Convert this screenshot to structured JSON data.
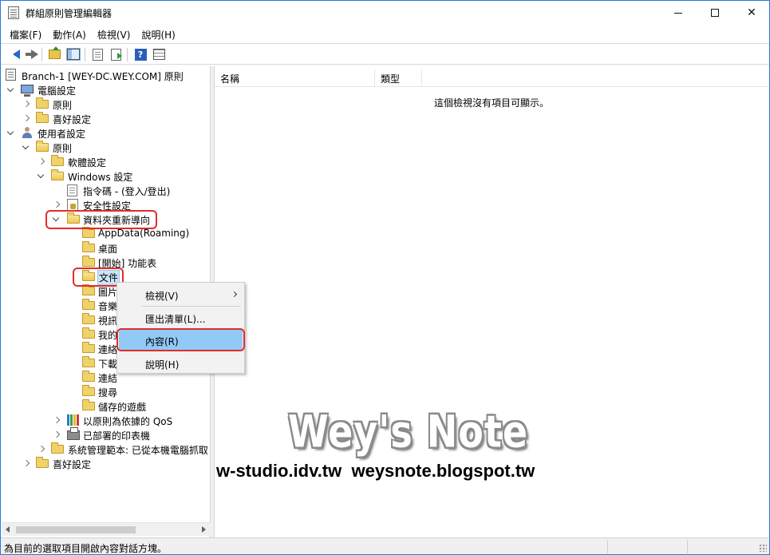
{
  "window": {
    "title": "群組原則管理編輯器",
    "minimize_glyph": "",
    "close_glyph": "✕"
  },
  "menubar": {
    "items": [
      "檔案(F)",
      "動作(A)",
      "檢視(V)",
      "說明(H)"
    ]
  },
  "toolbar": {
    "icons": [
      "back-arrow-icon",
      "forward-arrow-icon",
      "folder-up-icon",
      "show-hide-tree-icon",
      "properties-icon",
      "export-list-icon",
      "help-icon",
      "view-options-icon"
    ],
    "help_glyph": "?"
  },
  "tree": {
    "root": "Branch-1 [WEY-DC.WEY.COM] 原則",
    "computer_config": "電腦設定",
    "cc_policies": "原則",
    "cc_preferences": "喜好設定",
    "user_config": "使用者設定",
    "uc_policies": "原則",
    "software_settings": "軟體設定",
    "windows_settings": "Windows 設定",
    "scripts": "指令碼 - (登入/登出)",
    "security_settings": "安全性設定",
    "folder_redirection": "資料夾重新導向",
    "appdata": "AppData(Roaming)",
    "desktop": "桌面",
    "start_menu": "[開始] 功能表",
    "documents": "文件",
    "pictures": "圖片",
    "music": "音樂",
    "videos": "視訊",
    "favorites": "我的",
    "contacts": "連絡",
    "downloads": "下載",
    "links": "連結",
    "searches": "搜尋",
    "saved_games": "儲存的遊戲",
    "qos": "以原則為依據的 QoS",
    "deployed_printers": "已部署的印表機",
    "admin_templates": "系統管理範本: 已從本機電腦抓取",
    "uc_preferences": "喜好設定"
  },
  "list": {
    "columns": [
      "名稱",
      "類型"
    ],
    "empty_message": "這個檢視沒有項目可顯示。"
  },
  "context_menu": {
    "view": "檢視(V)",
    "export_list": "匯出清單(L)...",
    "properties": "內容(R)",
    "help": "說明(H)"
  },
  "watermark": {
    "title": "Wey's Note",
    "urls": "w-studio.idv.tw  weysnote.blogspot.tw"
  },
  "status": {
    "text": "為目前的選取項目開啟內容對話方塊。"
  },
  "colors": {
    "highlight_box": "#e22c2c",
    "menu_hover": "#91c9f7",
    "window_border": "#2b79d6"
  }
}
